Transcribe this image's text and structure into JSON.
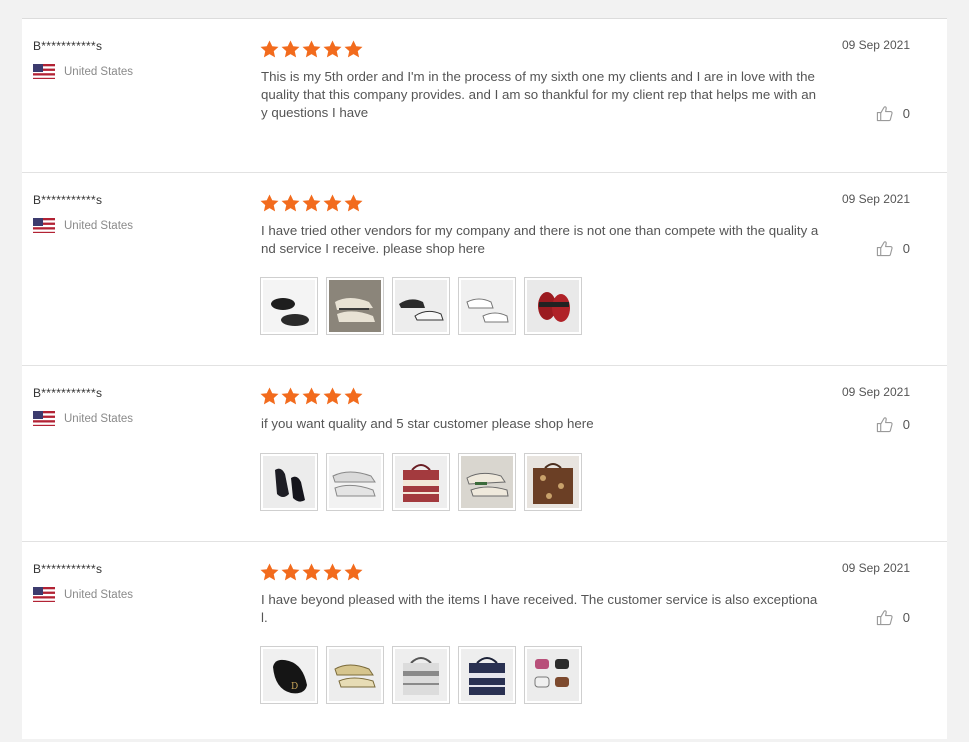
{
  "reviews": [
    {
      "user": "B***********s",
      "country": "United States",
      "rating": 5,
      "date": "09 Sep 2021",
      "text": "This is my 5th order and I'm in the process of my sixth one my clients and I are in love with the quality that this company provides. and I am so thankful for my client rep that helps me with any questions I have",
      "likes": "0",
      "photos": []
    },
    {
      "user": "B***********s",
      "country": "United States",
      "rating": 5,
      "date": "09 Sep 2021",
      "text": "I have tried other vendors for my company and there is not one than compete with the quality and service I receive. please shop here",
      "likes": "0",
      "photos": [
        "black sneaker pair",
        "beige sneaker pair",
        "black white sneakers",
        "white sneakers",
        "red slide sandals"
      ]
    },
    {
      "user": "B***********s",
      "country": "United States",
      "rating": 5,
      "date": "09 Sep 2021",
      "text": "if you want quality and 5 star customer please shop here",
      "likes": "0",
      "photos": [
        "black sandals",
        "white sneakers",
        "red tote bag",
        "sneaker pair",
        "brown monogram tote"
      ]
    },
    {
      "user": "B***********s",
      "country": "United States",
      "rating": 5,
      "date": "09 Sep 2021",
      "text": "I have beyond pleased with the items I have received. The customer service is also exceptional.",
      "likes": "0",
      "photos": [
        "black saddle bag",
        "gold sneakers",
        "white tote bag",
        "navy tote bag",
        "slide sandals"
      ]
    }
  ],
  "colors": {
    "star": "#f26b1d",
    "divider": "#e2e2e2",
    "muted": "#8a8a8a"
  }
}
